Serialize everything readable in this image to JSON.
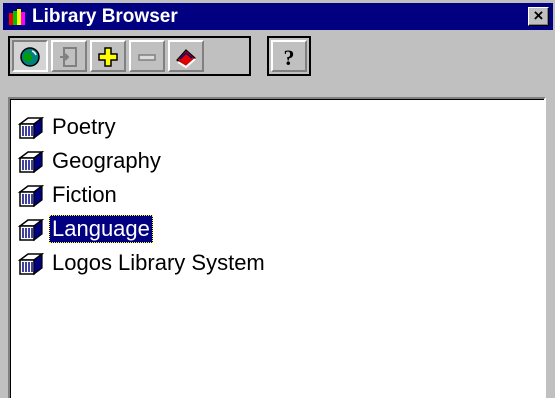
{
  "window": {
    "title": "Library Browser",
    "close_label": "×",
    "app_icon": "library-app-icon"
  },
  "toolbar": {
    "buttons": [
      {
        "name": "globe-icon",
        "state": "pressed"
      },
      {
        "name": "exit-door-icon",
        "state": "disabled"
      },
      {
        "name": "plus-icon",
        "state": "normal"
      },
      {
        "name": "minus-icon",
        "state": "disabled"
      },
      {
        "name": "book-icon",
        "state": "normal"
      },
      {
        "name": "help-icon",
        "state": "normal",
        "label": "?"
      }
    ]
  },
  "list": {
    "items": [
      {
        "label": "Poetry",
        "icon": "books-stack-icon",
        "selected": false
      },
      {
        "label": "Geography",
        "icon": "books-stack-icon",
        "selected": false
      },
      {
        "label": "Fiction",
        "icon": "books-stack-icon",
        "selected": false
      },
      {
        "label": "Language",
        "icon": "books-stack-icon",
        "selected": true
      },
      {
        "label": "Logos Library System",
        "icon": "books-stack-icon",
        "selected": false
      }
    ]
  },
  "colors": {
    "titlebar": "#000080",
    "selection": "#000080",
    "face": "#c0c0c0"
  }
}
